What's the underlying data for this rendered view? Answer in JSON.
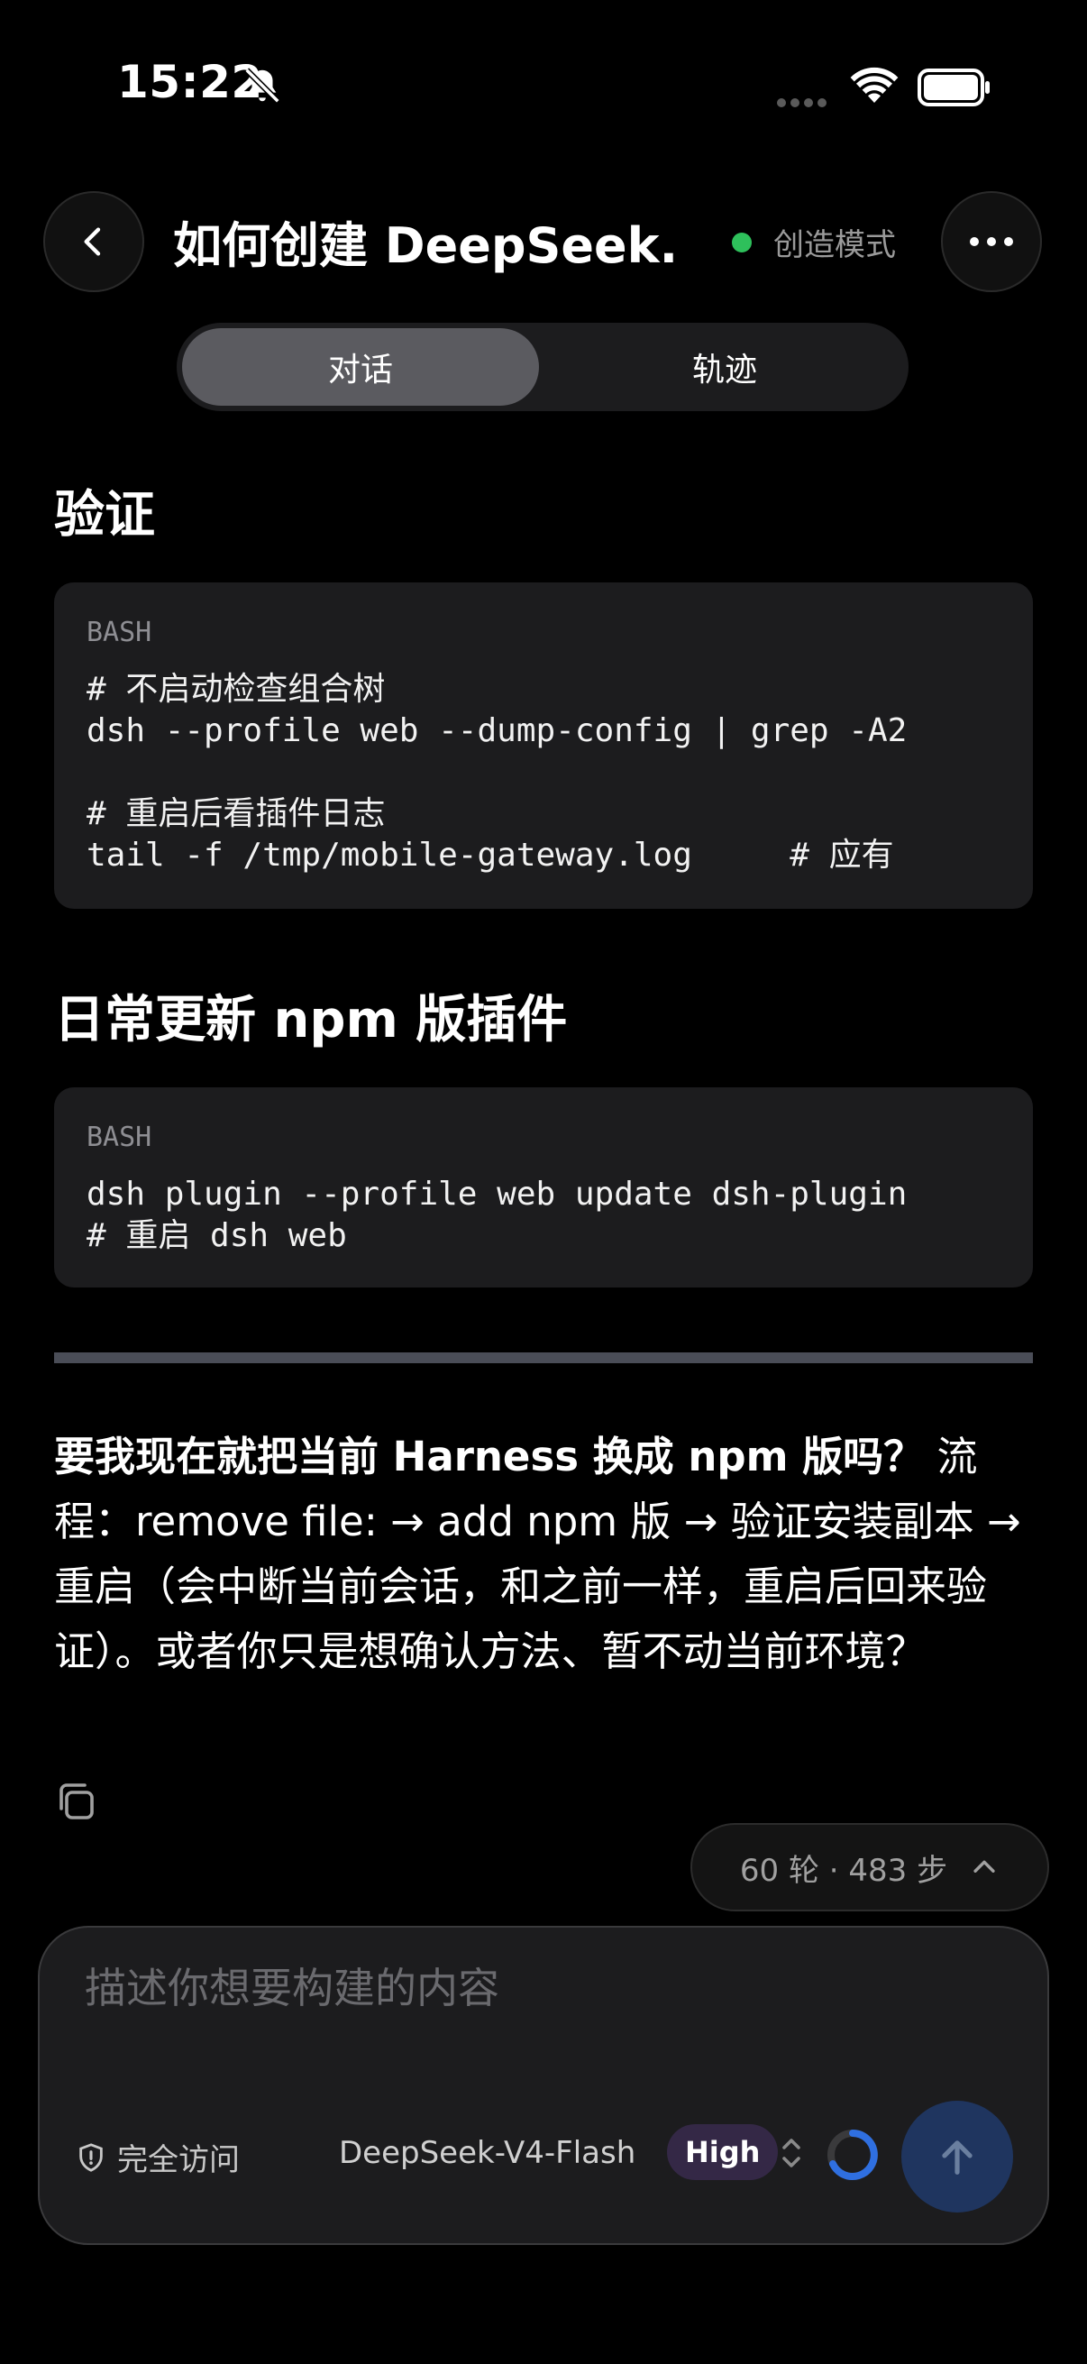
{
  "status_bar": {
    "time": "15:22"
  },
  "header": {
    "title": "如何创建 DeepSeek...",
    "mode_label": "创造模式",
    "mode_dot_color": "#2ec05b"
  },
  "tabs": [
    {
      "label": "对话",
      "active": true
    },
    {
      "label": "轨迹",
      "active": false
    }
  ],
  "content": {
    "section1_heading": "验证",
    "code1": {
      "lang": "BASH",
      "lines": [
        "# 不启动检查组合树",
        "dsh --profile web --dump-config | grep -A2",
        "",
        "# 重启后看插件日志",
        "tail -f /tmp/mobile-gateway.log     # 应有"
      ]
    },
    "section2_heading": "日常更新 npm 版插件",
    "code2": {
      "lang": "BASH",
      "lines": [
        "dsh plugin --profile web update dsh-plugin",
        "# 重启 dsh web"
      ]
    },
    "question_bold": "要我现在就把当前 Harness 换成 npm 版吗？",
    "question_rest": " 流程：remove file: → add npm 版 → 验证安装副本 → 重启（会中断当前会话，和之前一样，重启后回来验证）。或者你只是想确认方法、暂不动当前环境？"
  },
  "steps_pill": {
    "label": "60 轮 · 483 步"
  },
  "composer": {
    "placeholder": "描述你想要构建的内容",
    "access_label": "完全访问",
    "model_label": "DeepSeek-V4-Flash",
    "effort_badge": "High",
    "accent_color": "#2f6fe0"
  }
}
